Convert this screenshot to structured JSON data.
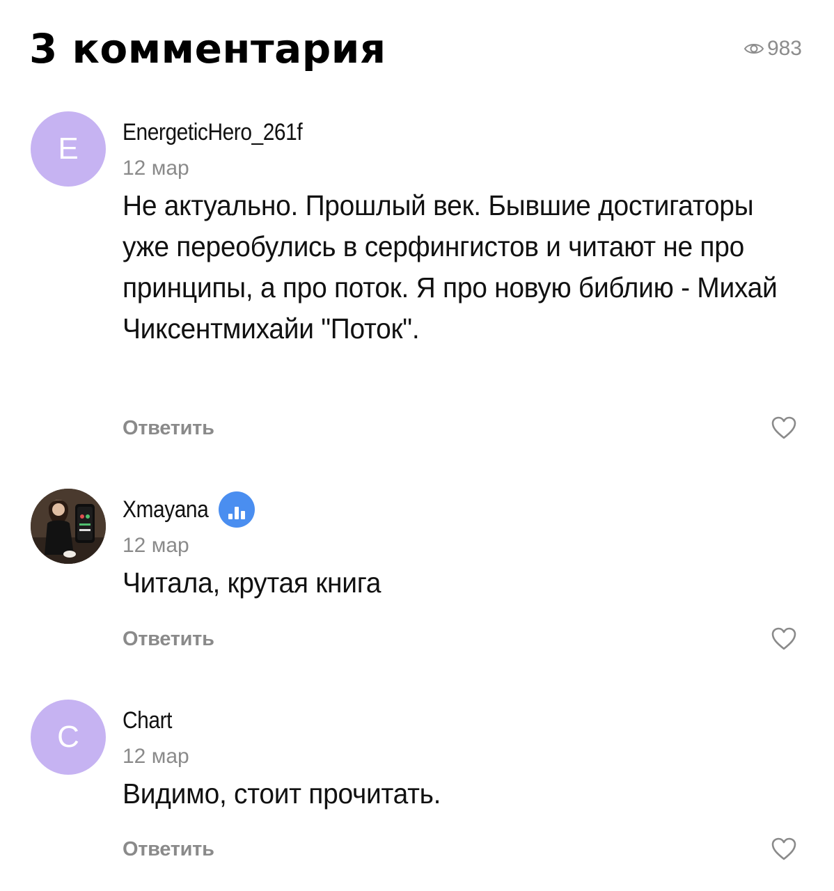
{
  "header": {
    "title": "3 комментария",
    "views": "983",
    "views_icon": "eye-icon"
  },
  "comments": [
    {
      "avatar_letter": "E",
      "avatar_color": "#c6b3f2",
      "author": "EnergeticHero_261f",
      "date": "12 мар",
      "text": "Не актуально. Прошлый век. Бывшие достигаторы уже переобулись в серфингистов и читают не про принципы, а про поток. Я про новую библию - Михай Чиксентмихайи \"Поток\".",
      "reply_label": "Ответить"
    },
    {
      "avatar_letter": "",
      "author": "Xmayana",
      "verified_badge_color": "#4a8ef0",
      "date": "12 мар",
      "text": "Читала, крутая книга",
      "reply_label": "Ответить"
    },
    {
      "avatar_letter": "C",
      "avatar_color": "#c6b3f2",
      "author": "Chart",
      "date": "12 мар",
      "text": "Видимо, стоит прочитать.",
      "reply_label": "Ответить"
    }
  ]
}
